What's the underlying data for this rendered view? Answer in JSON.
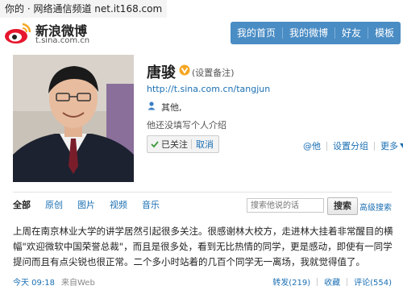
{
  "watermark": "你的 · 网络通信频道 net.it168.com",
  "brand": {
    "title": "新浪微博",
    "url": "t.sina.com.cn"
  },
  "nav": {
    "items": [
      "我的首页",
      "我的微博",
      "好友",
      "模板"
    ]
  },
  "profile": {
    "name": "唐骏",
    "set_remark": "(设置备注)",
    "url": "http://t.sina.com.cn/tangjun",
    "location": "其他,",
    "intro": "他还没填写个人介绍"
  },
  "follow": {
    "followed_label": "已关注",
    "cancel_label": "取消"
  },
  "actions": {
    "at_label": "@他",
    "set_group_label": "设置分组",
    "more_label": "更多"
  },
  "tabs": [
    "全部",
    "原创",
    "图片",
    "视频",
    "音乐"
  ],
  "search": {
    "placeholder": "搜索他说的话",
    "button_label": "搜索",
    "advanced_label": "高级搜索"
  },
  "tweet": {
    "text": "上周在南京林业大学的讲学居然引起很多关注。很感谢林大校方，走进林大挂着非常醒目的横幅\"欢迎微软中国荣誉总裁\"，而且是很多处，看到无比热情的同学，更是感动，即使有一同学提问而且有点尖锐也很正常。二个多小时站着的几百个同学无一离场，我就觉得值了。",
    "time": "今天 09:18",
    "source": "来自Web",
    "repost": "转发(219)",
    "favorite": "收藏",
    "comment": "评论(554)"
  },
  "colors": {
    "nav_bg": "#4a8cc4",
    "link": "#1b6fb3",
    "verified_badge": "#f5a623"
  }
}
